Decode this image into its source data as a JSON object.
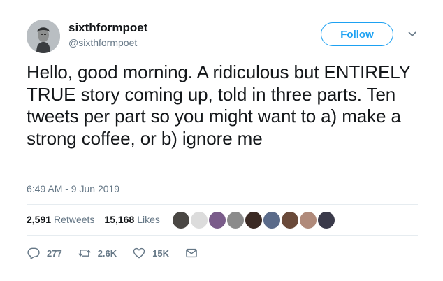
{
  "user": {
    "display_name": "sixthformpoet",
    "handle": "@sixthformpoet"
  },
  "follow_label": "Follow",
  "tweet": {
    "text": "Hello, good morning. A ridiculous but ENTIRELY TRUE story coming up, told in three parts. Ten tweets per part so you might want to a) make a strong coffee, or b) ignore me",
    "timestamp": "6:49 AM - 9 Jun 2019"
  },
  "stats": {
    "retweets_count": "2,591",
    "retweets_label": "Retweets",
    "likes_count": "15,168",
    "likes_label": "Likes"
  },
  "liker_avatar_colors": [
    "#4a4744",
    "#dcdcdc",
    "#7a5c8a",
    "#8b8b8b",
    "#3b2a24",
    "#5b6b8a",
    "#6a4a3a",
    "#b08a7a",
    "#3a3a4a"
  ],
  "actions": {
    "replies": "277",
    "retweets": "2.6K",
    "likes": "15K"
  },
  "colors": {
    "accent": "#1da1f2",
    "secondary_text": "#657786",
    "primary_text": "#14171a"
  }
}
